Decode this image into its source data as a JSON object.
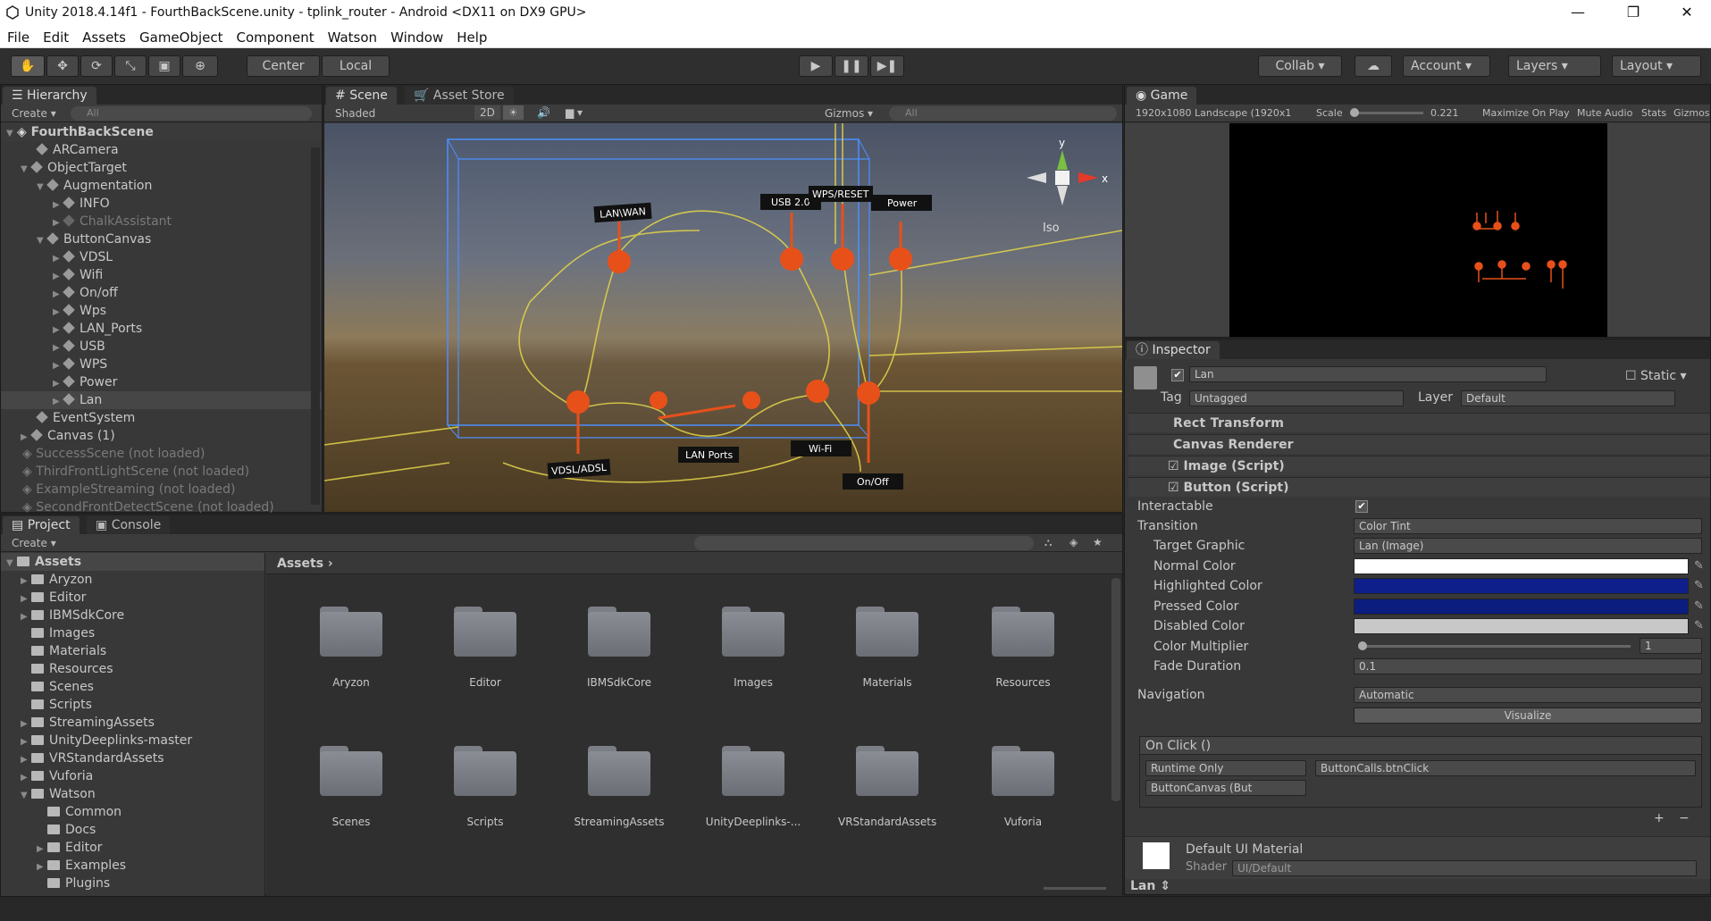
{
  "window": {
    "title": "Unity 2018.4.14f1 - FourthBackScene.unity - tplink_router - Android <DX11 on DX9 GPU>"
  },
  "menu": [
    "File",
    "Edit",
    "Assets",
    "GameObject",
    "Component",
    "Watson",
    "Window",
    "Help"
  ],
  "toolbar": {
    "center": "Center",
    "local": "Local",
    "collab": "Collab",
    "account": "Account",
    "layers": "Layers",
    "layout": "Layout"
  },
  "hierarchy": {
    "tab": "Hierarchy",
    "create": "Create",
    "search_placeholder": "All",
    "scene": "FourthBackScene",
    "items": [
      "ARCamera",
      "ObjectTarget",
      "Augmentation",
      "INFO",
      "ChalkAssistant",
      "ButtonCanvas",
      "VDSL",
      "Wifi",
      "On/off",
      "Wps",
      "LAN_Ports",
      "USB",
      "WPS",
      "Power",
      "Lan",
      "EventSystem",
      "Canvas (1)"
    ],
    "unloaded": [
      "SuccessScene (not loaded)",
      "ThirdFrontLightScene (not loaded)",
      "ExampleStreaming (not loaded)",
      "SecondFrontDetectScene (not loaded)"
    ]
  },
  "scene": {
    "tab_scene": "Scene",
    "tab_store": "Asset Store",
    "shading": "Shaded",
    "mode2d": "2D",
    "gizmos": "Gizmos",
    "search_placeholder": "All",
    "axis_y": "y",
    "axis_x": "x",
    "iso": "Iso",
    "labels": [
      "LAN\\WAN",
      "USB 2.0",
      "WPS/RESET",
      "Power",
      "VDSL/ADSL",
      "LAN Ports",
      "Wi-Fi",
      "On/Off"
    ]
  },
  "game": {
    "tab": "Game",
    "resolution": "1920x1080 Landscape (1920x1",
    "scale_label": "Scale",
    "scale_value": "0.221",
    "maximize": "Maximize On Play",
    "mute": "Mute Audio",
    "stats": "Stats",
    "gizmos": "Gizmos"
  },
  "inspector": {
    "tab": "Inspector",
    "object_name": "Lan",
    "static": "Static",
    "tag_label": "Tag",
    "tag": "Untagged",
    "layer_label": "Layer",
    "layer": "Default",
    "components": [
      "Rect Transform",
      "Canvas Renderer",
      "Image (Script)",
      "Button (Script)"
    ],
    "interactable": "Interactable",
    "transition": "Transition",
    "transition_value": "Color Tint",
    "target_graphic": "Target Graphic",
    "target_graphic_value": "Lan (Image)",
    "normal_color": "Normal Color",
    "highlighted_color": "Highlighted Color",
    "pressed_color": "Pressed Color",
    "disabled_color": "Disabled Color",
    "color_multiplier": "Color Multiplier",
    "color_multiplier_value": "1",
    "fade_duration": "Fade Duration",
    "fade_duration_value": "0.1",
    "navigation": "Navigation",
    "navigation_value": "Automatic",
    "visualize": "Visualize",
    "onclick": "On Click ()",
    "runtime": "Runtime Only",
    "callback": "ButtonCalls.btnClick",
    "object_ref": "ButtonCanvas (But",
    "plus": "+",
    "minus": "−",
    "material": "Default UI Material",
    "shader_label": "Shader",
    "shader": "UI/Default",
    "footer": "Lan"
  },
  "project": {
    "tab": "Project",
    "console_tab": "Console",
    "create": "Create",
    "breadcrumb": "Assets",
    "tree": [
      "Assets",
      "Aryzon",
      "Editor",
      "IBMSdkCore",
      "Images",
      "Materials",
      "Resources",
      "Scenes",
      "Scripts",
      "StreamingAssets",
      "UnityDeeplinks-master",
      "VRStandardAssets",
      "Vuforia",
      "Watson",
      "Common",
      "Docs",
      "Editor",
      "Examples",
      "Plugins"
    ],
    "folders": [
      "Aryzon",
      "Editor",
      "IBMSdkCore",
      "Images",
      "Materials",
      "Resources",
      "Scenes",
      "Scripts",
      "StreamingAssets",
      "UnityDeeplinks-...",
      "VRStandardAssets",
      "Vuforia"
    ]
  },
  "colors": {
    "normal": "#ffffff",
    "highlighted": "#0e1f8c",
    "pressed": "#0b1d7e",
    "disabled": "#c8c8c8",
    "accent_orange": "#e8501a"
  }
}
